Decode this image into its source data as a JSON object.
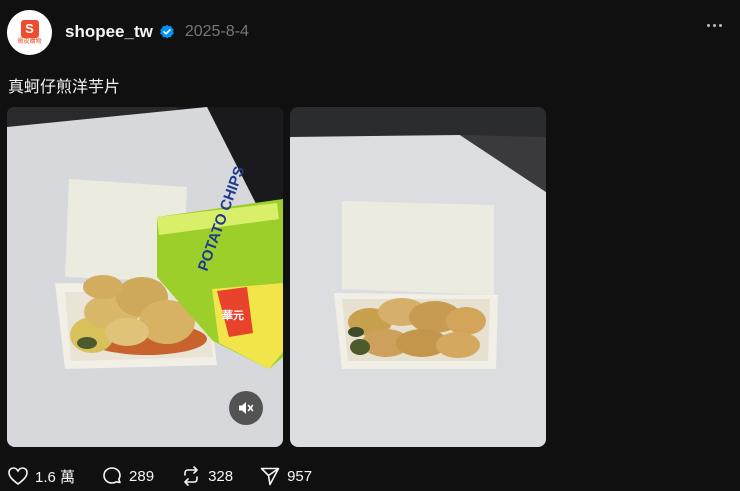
{
  "post": {
    "author": "shopee_tw",
    "date": "2025-8-4",
    "avatar_label": "蝦皮購物",
    "avatar_glyph": "S",
    "text": "真蚵仔煎洋芋片",
    "chip_bag_label": "POTATO CHIPS",
    "chip_bag_brand": "華元"
  },
  "actions": {
    "likes": "1.6 萬",
    "comments": "289",
    "reposts": "328",
    "shares": "957"
  },
  "icons": {
    "verified": "verified-badge-icon",
    "more": "more-icon",
    "mute": "mute-icon",
    "like": "heart-icon",
    "comment": "comment-icon",
    "repost": "repost-icon",
    "share": "send-icon"
  },
  "colors": {
    "background": "#101010",
    "brand": "#ee4d2d",
    "verified": "#0095f6",
    "muted_text": "#777777"
  }
}
